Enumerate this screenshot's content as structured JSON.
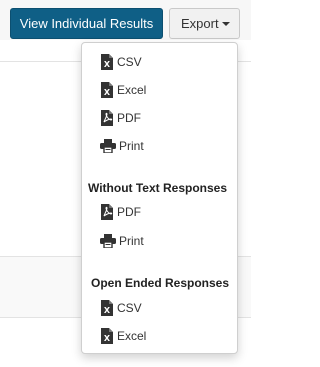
{
  "toolbar": {
    "results_label": "View Individual Results",
    "export_label": "Export"
  },
  "menu": {
    "items": [
      {
        "label": "CSV",
        "icon": "file-excel-icon"
      },
      {
        "label": "Excel",
        "icon": "file-excel-icon"
      },
      {
        "label": "PDF",
        "icon": "file-pdf-icon"
      },
      {
        "label": "Print",
        "icon": "printer-icon"
      }
    ],
    "sections": [
      {
        "header": "Without Text Responses",
        "items": [
          {
            "label": "PDF",
            "icon": "file-pdf-icon"
          },
          {
            "label": "Print",
            "icon": "printer-icon"
          }
        ]
      },
      {
        "header": "Open Ended Responses",
        "items": [
          {
            "label": "CSV",
            "icon": "file-excel-icon"
          },
          {
            "label": "Excel",
            "icon": "file-excel-icon"
          }
        ]
      }
    ]
  },
  "colors": {
    "primary_button": "#0f5f86",
    "icon": "#333333"
  }
}
